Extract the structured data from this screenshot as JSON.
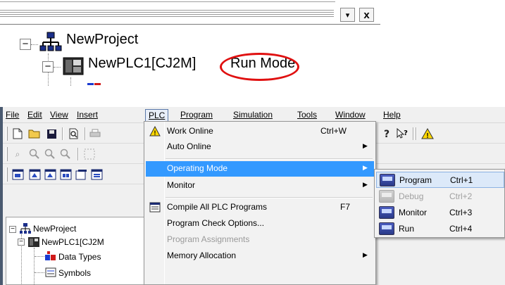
{
  "top": {
    "project_label": "NewProject",
    "plc_label": "NewPLC1[CJ2M]",
    "mode_label": "Run Mode",
    "close_glyph": "x",
    "dropdown_glyph": "▾",
    "highlight_color": "#e01010"
  },
  "menubar": {
    "items": [
      {
        "label": "File"
      },
      {
        "label": "Edit"
      },
      {
        "label": "View"
      },
      {
        "label": "Insert"
      },
      {
        "label": "PLC"
      },
      {
        "label": "Program"
      },
      {
        "label": "Simulation"
      },
      {
        "label": "Tools"
      },
      {
        "label": "Window"
      },
      {
        "label": "Help"
      }
    ]
  },
  "toolbar_icons": {
    "row1": [
      "new-file-icon",
      "open-folder-icon",
      "save-icon",
      "print-preview-icon",
      "print-icon",
      "about-icon",
      "help-icon",
      "context-help-icon",
      "warning-icon"
    ],
    "row2": [
      "find-icon",
      "zoom-out-icon",
      "zoom-in-icon",
      "zoom-icon",
      "grid-icon"
    ],
    "row3": [
      "window-1-icon",
      "window-2-icon",
      "window-3-icon",
      "window-4-icon",
      "window-5-icon",
      "window-6-icon"
    ]
  },
  "plc_menu": {
    "items": [
      {
        "label": "Work Online",
        "shortcut": "Ctrl+W",
        "has_icon": true,
        "submenu": false,
        "disabled": false
      },
      {
        "label": "Auto Online",
        "shortcut": "",
        "has_icon": false,
        "submenu": true,
        "disabled": false
      },
      {
        "label": "Operating Mode",
        "shortcut": "",
        "has_icon": false,
        "submenu": true,
        "disabled": false,
        "highlighted": true
      },
      {
        "label": "Monitor",
        "shortcut": "",
        "has_icon": false,
        "submenu": true,
        "disabled": false
      },
      {
        "label": "Compile All PLC Programs",
        "shortcut": "F7",
        "has_icon": true,
        "submenu": false,
        "disabled": false
      },
      {
        "label": "Program Check Options...",
        "shortcut": "",
        "has_icon": false,
        "submenu": false,
        "disabled": false
      },
      {
        "label": "Program Assignments",
        "shortcut": "",
        "has_icon": false,
        "submenu": false,
        "disabled": true
      },
      {
        "label": "Memory Allocation",
        "shortcut": "",
        "has_icon": false,
        "submenu": true,
        "disabled": false
      }
    ],
    "highlight_color": "#3399ff"
  },
  "operating_mode_submenu": {
    "items": [
      {
        "label": "Program",
        "shortcut": "Ctrl+1",
        "disabled": false,
        "highlighted": true
      },
      {
        "label": "Debug",
        "shortcut": "Ctrl+2",
        "disabled": true
      },
      {
        "label": "Monitor",
        "shortcut": "Ctrl+3",
        "disabled": false
      },
      {
        "label": "Run",
        "shortcut": "Ctrl+4",
        "disabled": false
      }
    ]
  },
  "project_tree": {
    "root": "NewProject",
    "plc": "NewPLC1[CJ2M",
    "children": [
      "Data Types",
      "Symbols"
    ]
  }
}
